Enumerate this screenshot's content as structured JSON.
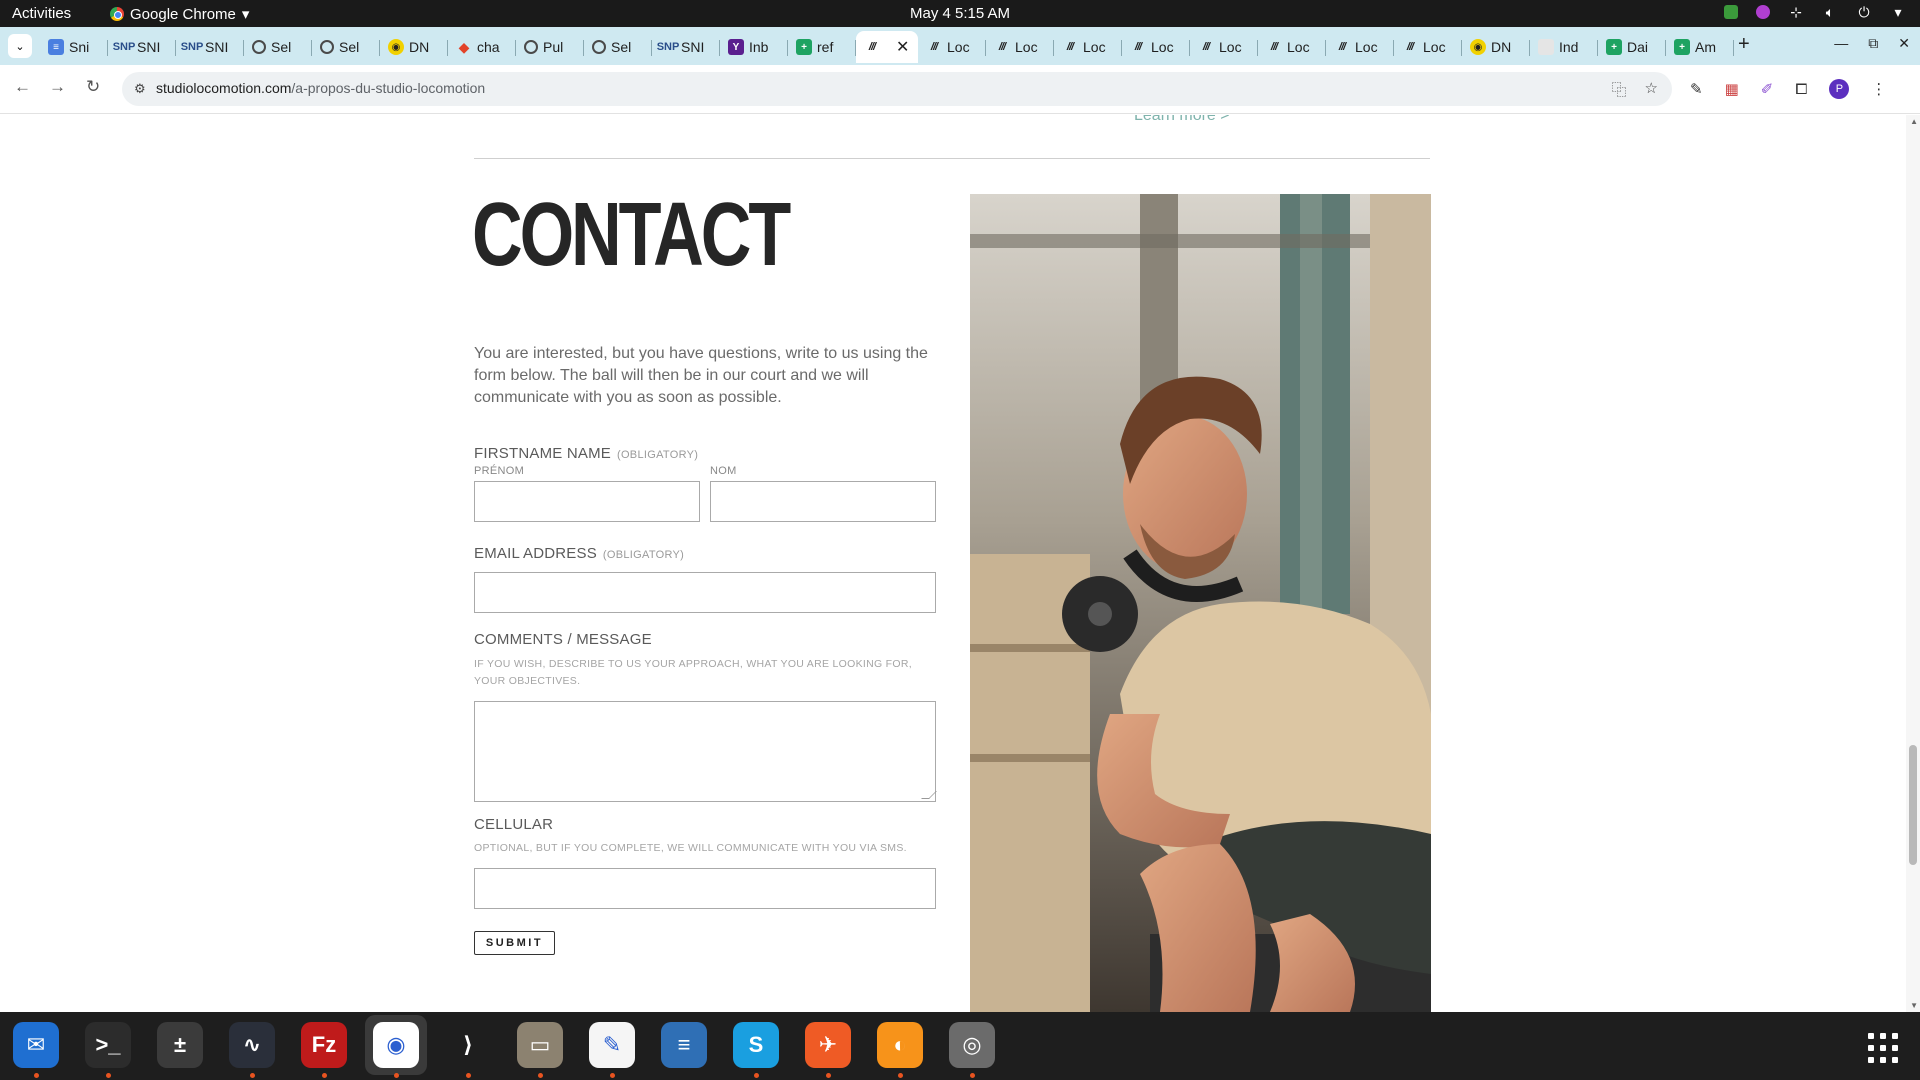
{
  "topbar": {
    "activities": "Activities",
    "app_name": "Google Chrome",
    "clock": "May 4  5:15 AM"
  },
  "tabs": [
    {
      "label": "Sni",
      "icon": "docs-icon"
    },
    {
      "label": "SNI",
      "icon": "snp-icon"
    },
    {
      "label": "SNI",
      "icon": "snp-icon"
    },
    {
      "label": "Sel",
      "icon": "globe-icon"
    },
    {
      "label": "Sel",
      "icon": "globe-icon"
    },
    {
      "label": "DN",
      "icon": "dn-icon"
    },
    {
      "label": "cha",
      "icon": "gitlab-icon"
    },
    {
      "label": "Pul",
      "icon": "globe-icon"
    },
    {
      "label": "Sel",
      "icon": "globe-icon"
    },
    {
      "label": "SNI",
      "icon": "snp-icon"
    },
    {
      "label": "Inb",
      "icon": "yahoo-icon"
    },
    {
      "label": "ref",
      "icon": "sheets-icon"
    },
    {
      "label": "",
      "icon": "locomotion-icon",
      "active": true
    },
    {
      "label": "Loc",
      "icon": "locomotion-icon"
    },
    {
      "label": "Loc",
      "icon": "locomotion-icon"
    },
    {
      "label": "Loc",
      "icon": "locomotion-icon"
    },
    {
      "label": "Loc",
      "icon": "locomotion-icon"
    },
    {
      "label": "Loc",
      "icon": "locomotion-icon"
    },
    {
      "label": "Loc",
      "icon": "locomotion-icon"
    },
    {
      "label": "Loc",
      "icon": "locomotion-icon"
    },
    {
      "label": "Loc",
      "icon": "locomotion-icon"
    },
    {
      "label": "DN",
      "icon": "dn-icon"
    },
    {
      "label": "Ind",
      "icon": "page-icon"
    },
    {
      "label": "Dai",
      "icon": "sheets-icon"
    },
    {
      "label": "Am",
      "icon": "sheets-icon"
    }
  ],
  "omnibox": {
    "domain": "studiolocomotion.com",
    "path": "/a-propos-du-studio-locomotion"
  },
  "page": {
    "learn_more": "Learn more >",
    "title": "CONTACT",
    "intro": "You are interested, but you have questions, write to us using the form below. The ball will then be in our court and we will communicate with you as soon as possible.",
    "name_label": "FIRSTNAME NAME",
    "name_obligatory": "(OBLIGATORY)",
    "firstname_sublabel": "PRÉNOM",
    "lastname_sublabel": "NOM",
    "firstname_value": "",
    "lastname_value": "",
    "email_label": "EMAIL ADDRESS",
    "email_obligatory": "(OBLIGATORY)",
    "email_value": "",
    "comments_label": "COMMENTS / MESSAGE",
    "comments_help": "IF YOU WISH, DESCRIBE TO US YOUR APPROACH, WHAT YOU ARE LOOKING FOR, YOUR OBJECTIVES.",
    "comments_value": "",
    "cellular_label": "CELLULAR",
    "cellular_help": "OPTIONAL, BUT IF YOU COMPLETE, WE WILL COMMUNICATE WITH YOU VIA SMS.",
    "cellular_value": "",
    "submit_label": "SUBMIT"
  },
  "dock": [
    {
      "name": "thunderbird-icon",
      "color": "#1f6fd1"
    },
    {
      "name": "terminal-icon",
      "color": "#2c2c2c"
    },
    {
      "name": "calculator-icon",
      "color": "#3b3b3b"
    },
    {
      "name": "system-monitor-icon",
      "color": "#2a2f3a"
    },
    {
      "name": "filezilla-icon",
      "color": "#bf1b1b"
    },
    {
      "name": "chrome-icon",
      "color": "#ffffff"
    },
    {
      "name": "vscode-icon",
      "color": "#1e1e1e"
    },
    {
      "name": "files-icon",
      "color": "#8c8270"
    },
    {
      "name": "text-editor-icon",
      "color": "#f5f5f5"
    },
    {
      "name": "writer-icon",
      "color": "#2f6fb5"
    },
    {
      "name": "skype-icon",
      "color": "#1a9fe0"
    },
    {
      "name": "postman-icon",
      "color": "#ef5b25"
    },
    {
      "name": "flame-icon",
      "color": "#f7931a"
    },
    {
      "name": "disk-icon",
      "color": "#6b6b6b"
    }
  ]
}
